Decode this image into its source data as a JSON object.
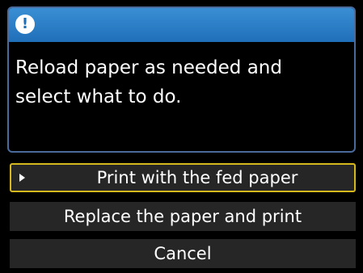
{
  "dialog": {
    "icon": "exclamation-icon",
    "icon_glyph": "!",
    "message": "Reload paper as needed and\nselect what to do."
  },
  "options": [
    {
      "label": "Print with the fed paper",
      "selected": true
    },
    {
      "label": "Replace the paper and print",
      "selected": false
    },
    {
      "label": "Cancel",
      "selected": false
    }
  ],
  "colors": {
    "header": "#2a7fc6",
    "selection_border": "#d4b81e",
    "option_bg": "#262626"
  }
}
